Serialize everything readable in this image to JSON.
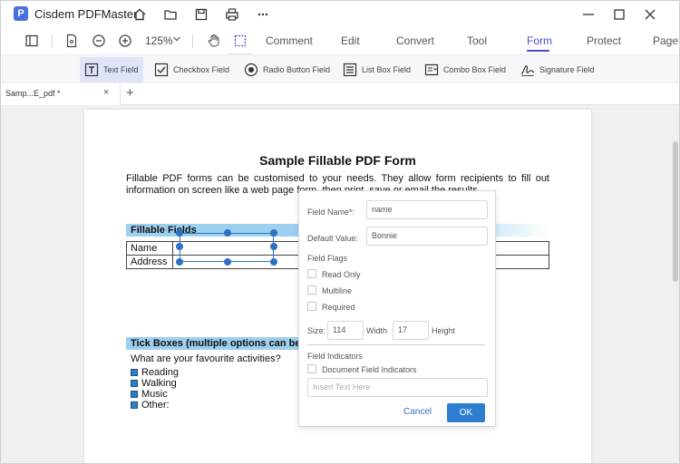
{
  "app": {
    "title": "Cisdem PDFMaster",
    "logo_letter": "P"
  },
  "titlebar": {
    "icons": [
      "home-icon",
      "folder-icon",
      "save-icon",
      "print-icon",
      "more-icon",
      "minimize-icon",
      "maximize-icon",
      "close-icon"
    ]
  },
  "toolbar": {
    "zoom": "125%",
    "tabs": [
      "Comment",
      "Edit",
      "Convert",
      "Tool",
      "Form",
      "Protect",
      "Page"
    ],
    "active_tab": "Form"
  },
  "form_tools": [
    "Text Field",
    "Checkbox Field",
    "Radio Button Field",
    "List Box Field",
    "Combo Box Field",
    "Signature Field"
  ],
  "doc_tab": {
    "label": "Samp...E_pdf *",
    "close": "×",
    "add": "+"
  },
  "pdf": {
    "title": "Sample Fillable PDF Form",
    "intro": "Fillable PDF forms can be customised to your needs. They allow form recipients to fill out information on screen like a web page form, then print, save or email the results.",
    "section_fillable": "Fillable Fields",
    "rows": [
      "Name",
      "Address"
    ],
    "section_tick": "Tick Boxes (multiple options can be",
    "question": "What are your favourite activities?",
    "options": [
      "Reading",
      "Walking",
      "Music",
      "Other:"
    ]
  },
  "popup": {
    "field_name_label": "Field Name*:",
    "field_name_value": "name",
    "default_value_label": "Default Value:",
    "default_value_value": "Bonnie",
    "field_flags_label": "Field Flags",
    "flags": [
      "Read Only",
      "Multiline",
      "Required"
    ],
    "size_label": "Size:",
    "size_value": "114",
    "width_label": "Width",
    "width_value": "17",
    "height_label": "Height",
    "field_indicators_label": "Field Indicators",
    "doc_field_indicators_label": "Document Field Indicators",
    "insert_text_placeholder": "Insert Text Here",
    "cancel": "Cancel",
    "ok": "OK"
  },
  "colors": {
    "accent": "#4a4ec7",
    "section_blue": "#9dd0ef",
    "ok_button": "#2f7fd0",
    "selection_handle": "#2f6fbf"
  }
}
